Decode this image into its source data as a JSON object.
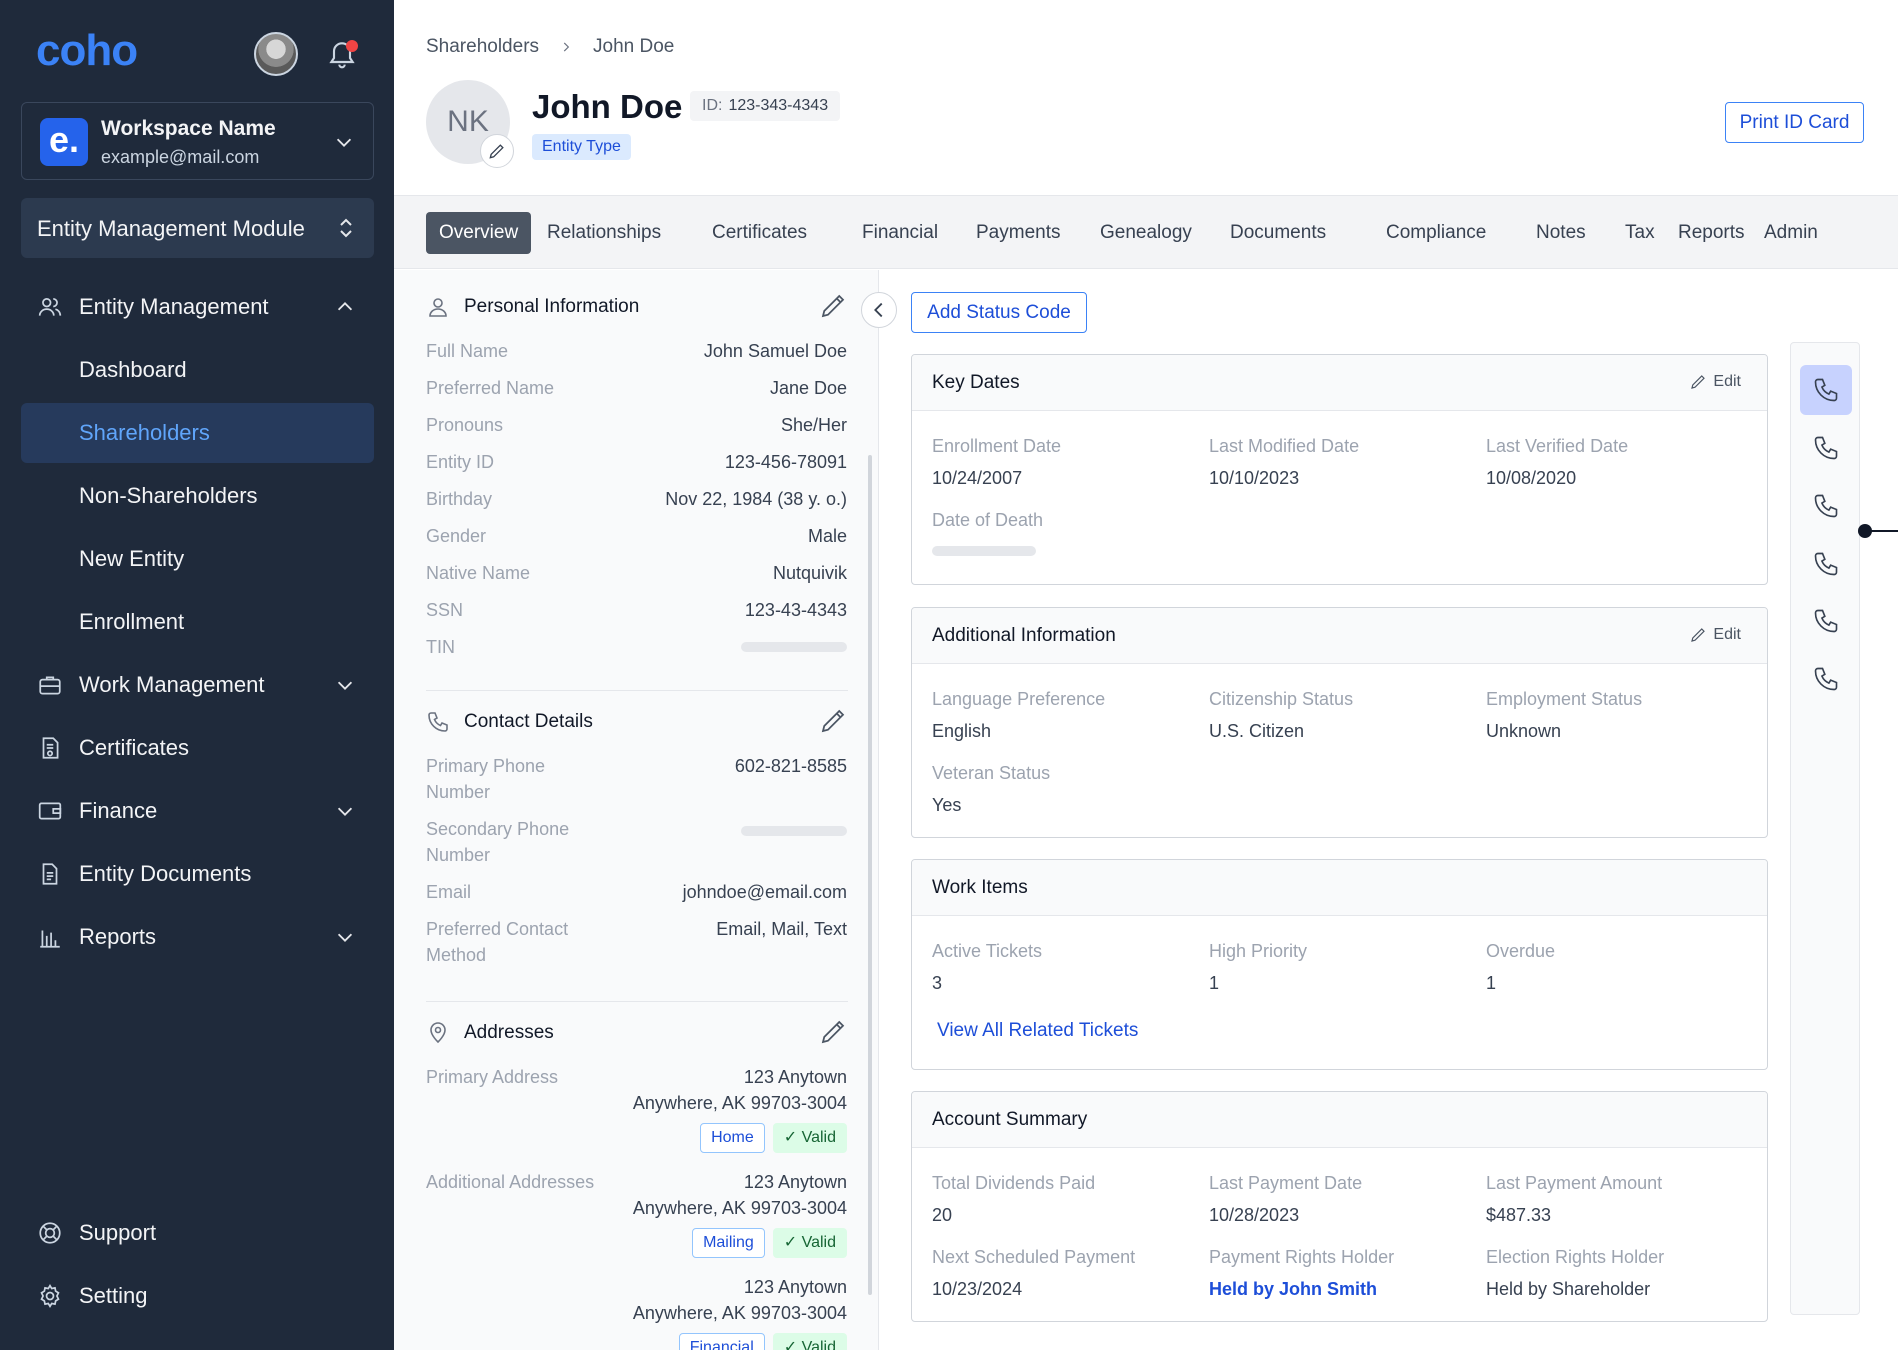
{
  "sidebar": {
    "logo": "coho",
    "workspace": {
      "logo_letter": "e.",
      "name": "Workspace Name",
      "email": "example@mail.com"
    },
    "module": "Entity Management Module",
    "nav": {
      "entity_management": "Entity Management",
      "dashboard": "Dashboard",
      "shareholders": "Shareholders",
      "non_shareholders": "Non-Shareholders",
      "new_entity": "New Entity",
      "enrollment": "Enrollment",
      "work_management": "Work Management",
      "certificates": "Certificates",
      "finance": "Finance",
      "entity_documents": "Entity Documents",
      "reports": "Reports",
      "support": "Support",
      "setting": "Setting"
    },
    "active_item": "Shareholders"
  },
  "header": {
    "breadcrumb": [
      "Shareholders",
      "John Doe"
    ],
    "avatar_initials": "NK",
    "name": "John Doe",
    "id_label": "ID:",
    "id_value": "123-343-4343",
    "entity_type": "Entity Type",
    "print_button": "Print ID Card"
  },
  "tabs": [
    "Overview",
    "Relationships",
    "Certificates",
    "Financial",
    "Payments",
    "Genealogy",
    "Documents",
    "Compliance",
    "Notes",
    "Tax",
    "Reports",
    "Admin"
  ],
  "active_tab": "Overview",
  "personal_info": {
    "title": "Personal Information",
    "fields": [
      {
        "label": "Full Name",
        "value": "John Samuel Doe"
      },
      {
        "label": "Preferred Name",
        "value": "Jane Doe"
      },
      {
        "label": "Pronouns",
        "value": "She/Her"
      },
      {
        "label": "Entity ID",
        "value": "123-456-78091"
      },
      {
        "label": "Birthday",
        "value": "Nov 22, 1984 (38 y. o.)"
      },
      {
        "label": "Gender",
        "value": "Male"
      },
      {
        "label": "Native Name",
        "value": "Nutquivik"
      },
      {
        "label": "SSN",
        "value": "123-43-4343"
      },
      {
        "label": "TIN",
        "value": ""
      }
    ]
  },
  "contact_details": {
    "title": "Contact Details",
    "fields": [
      {
        "label": "Primary Phone Number",
        "value": "602-821-8585"
      },
      {
        "label": "Secondary Phone Number",
        "value": ""
      },
      {
        "label": "Email",
        "value": "johndoe@email.com"
      },
      {
        "label": "Preferred Contact Method",
        "value": "Email, Mail, Text"
      }
    ]
  },
  "addresses": {
    "title": "Addresses",
    "items": [
      {
        "label": "Primary Address",
        "line1": "123 Anytown",
        "line2": "Anywhere, AK 99703-3004",
        "type": "Home",
        "status": "Valid"
      },
      {
        "label": "Additional Addresses",
        "line1": "123 Anytown",
        "line2": "Anywhere, AK 99703-3004",
        "type": "Mailing",
        "status": "Valid"
      },
      {
        "label": "",
        "line1": "123 Anytown",
        "line2": "Anywhere, AK 99703-3004",
        "type": "Financial",
        "status": "Valid"
      }
    ]
  },
  "add_status_button": "Add Status Code",
  "edit_label": "Edit",
  "key_dates": {
    "title": "Key Dates",
    "enrollment_label": "Enrollment Date",
    "enrollment_value": "10/24/2007",
    "modified_label": "Last Modified Date",
    "modified_value": "10/10/2023",
    "verified_label": "Last Verified Date",
    "verified_value": "10/08/2020",
    "death_label": "Date of Death"
  },
  "additional_info": {
    "title": "Additional Information",
    "language_label": "Language Preference",
    "language_value": "English",
    "citizenship_label": "Citizenship Status",
    "citizenship_value": "U.S. Citizen",
    "employment_label": "Employment Status",
    "employment_value": "Unknown",
    "veteran_label": "Veteran Status",
    "veteran_value": "Yes"
  },
  "work_items": {
    "title": "Work Items",
    "active_label": "Active Tickets",
    "active_value": "3",
    "priority_label": "High Priority",
    "priority_value": "1",
    "overdue_label": "Overdue",
    "overdue_value": "1",
    "view_all": "View All Related Tickets"
  },
  "account_summary": {
    "title": "Account Summary",
    "dividends_label": "Total Dividends Paid",
    "dividends_value": "20",
    "last_date_label": "Last Payment Date",
    "last_date_value": "10/28/2023",
    "last_amount_label": "Last Payment Amount",
    "last_amount_value": "$487.33",
    "next_label": "Next Scheduled Payment",
    "next_value": "10/23/2024",
    "payment_rights_label": "Payment Rights Holder",
    "payment_rights_value": "Held by John Smith",
    "election_label": "Election Rights Holder",
    "election_value": "Held by Shareholder"
  },
  "colors": {
    "sidebar_bg": "#1f2a3b",
    "accent": "#1d4ed8",
    "active_nav": "#60a5fa",
    "notification": "#ef4444"
  }
}
